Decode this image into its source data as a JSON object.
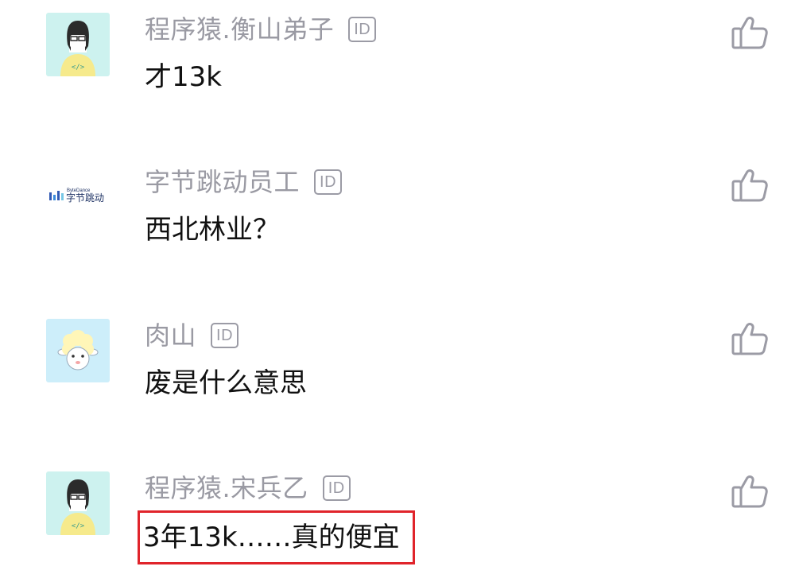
{
  "comments": [
    {
      "avatar_icon": "programmer-avatar-icon",
      "username": "程序猿.衡山弟子",
      "badge": "ID",
      "text": "才13k",
      "like_icon": "thumbs-up-icon"
    },
    {
      "avatar_icon": "bytedance-logo",
      "logo_text_en": "ByteDance",
      "logo_text_cn": "字节跳动",
      "username": "字节跳动员工",
      "badge": "ID",
      "text": "西北林业？",
      "like_icon": "thumbs-up-icon"
    },
    {
      "avatar_icon": "sheep-avatar-icon",
      "username": "肉山",
      "badge": "ID",
      "text": "废是什么意思",
      "like_icon": "thumbs-up-icon"
    },
    {
      "avatar_icon": "programmer-avatar-icon",
      "username": "程序猿.宋兵乙",
      "badge": "ID",
      "text": "3年13k……真的便宜",
      "highlighted": true,
      "like_icon": "thumbs-up-icon"
    }
  ],
  "colors": {
    "username": "#9a9aa3",
    "text": "#111111",
    "highlight_box": "#e0242b",
    "avatar_bg": "#cdf2ef",
    "icon_stroke": "#9b9ba5"
  }
}
